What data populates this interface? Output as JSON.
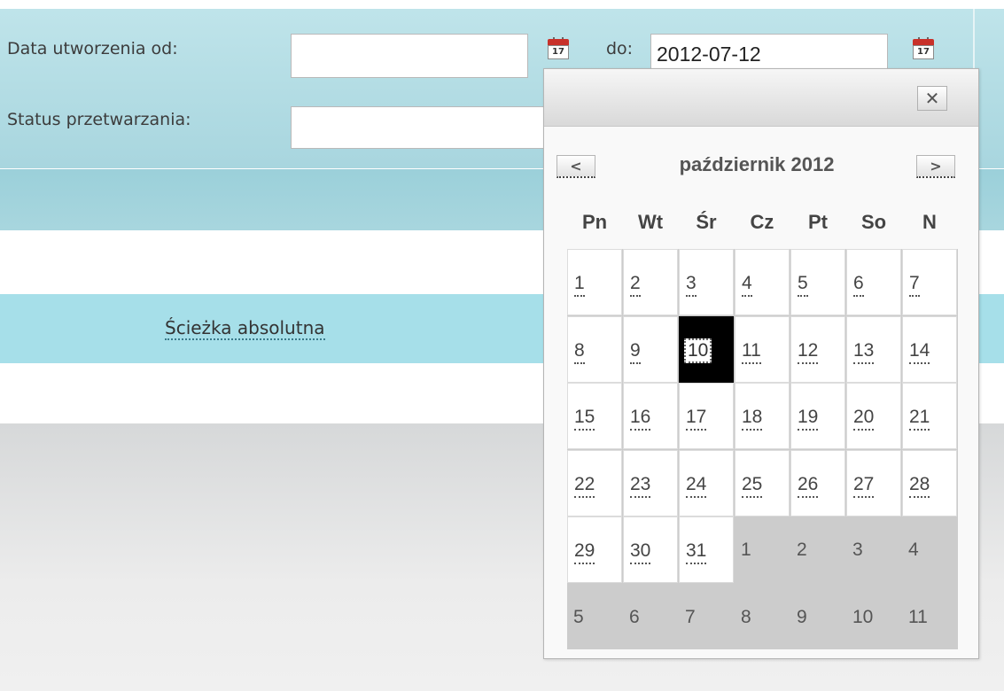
{
  "form": {
    "date_from_label": "Data utworzenia od:",
    "date_from_value": "",
    "date_to_label": "do:",
    "date_to_value": "2012-07-12",
    "status_label": "Status przetwarzania:",
    "status_value": "",
    "calendar_icon_text": "17"
  },
  "links": {
    "absolute_path": "Ścieżka absolutna"
  },
  "datepicker": {
    "close_label": "✕",
    "prev_label": "<",
    "next_label": ">",
    "month_title": "październik 2012",
    "weekdays": [
      "Pn",
      "Wt",
      "Śr",
      "Cz",
      "Pt",
      "So",
      "N"
    ],
    "selected_day": "10",
    "weeks": [
      [
        "1",
        "2",
        "3",
        "4",
        "5",
        "6",
        "7"
      ],
      [
        "8",
        "9",
        "10",
        "11",
        "12",
        "13",
        "14"
      ],
      [
        "15",
        "16",
        "17",
        "18",
        "19",
        "20",
        "21"
      ],
      [
        "22",
        "23",
        "24",
        "25",
        "26",
        "27",
        "28"
      ],
      [
        "29",
        "30",
        "31",
        "1",
        "2",
        "3",
        "4"
      ],
      [
        "5",
        "6",
        "7",
        "8",
        "9",
        "10",
        "11"
      ]
    ],
    "other_month_days": [
      "1",
      "2",
      "3",
      "4",
      "5",
      "6",
      "7",
      "8",
      "9",
      "10",
      "11"
    ]
  }
}
